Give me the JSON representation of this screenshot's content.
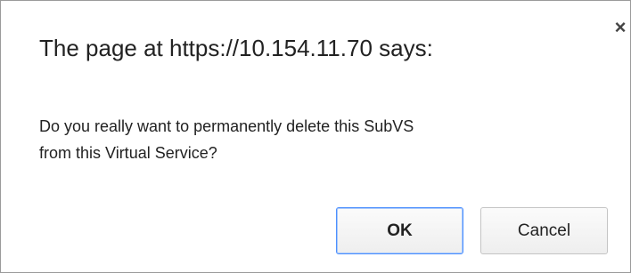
{
  "dialog": {
    "title": "The page at https://10.154.11.70 says:",
    "close_glyph": "×",
    "message_line1": "Do you really want to permanently delete this SubVS",
    "message_line2": "from this Virtual Service?",
    "ok_label": "OK",
    "cancel_label": "Cancel"
  }
}
